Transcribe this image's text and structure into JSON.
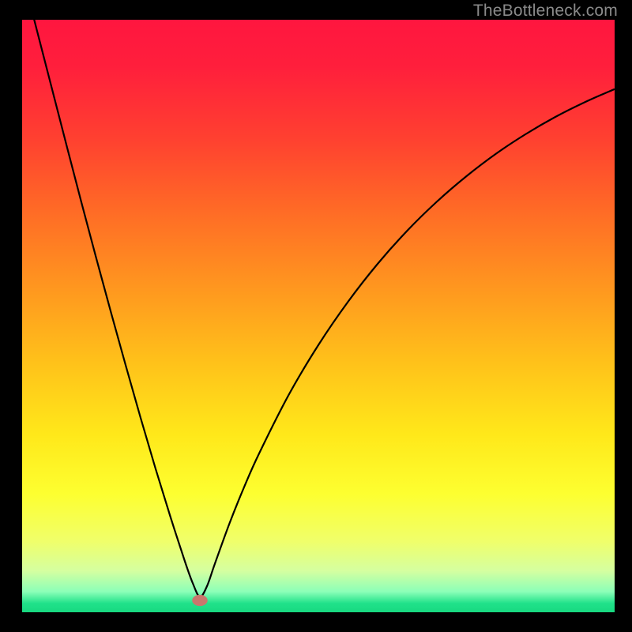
{
  "watermark": "TheBottleneck.com",
  "chart_data": {
    "type": "line",
    "title": "",
    "xlabel": "",
    "ylabel": "",
    "xlim": [
      0,
      100
    ],
    "ylim": [
      0,
      100
    ],
    "background_gradient": {
      "stops": [
        {
          "offset": 0.0,
          "color": "#ff163f"
        },
        {
          "offset": 0.08,
          "color": "#ff1f3c"
        },
        {
          "offset": 0.2,
          "color": "#ff4030"
        },
        {
          "offset": 0.32,
          "color": "#ff6a26"
        },
        {
          "offset": 0.45,
          "color": "#ff961f"
        },
        {
          "offset": 0.58,
          "color": "#ffc21a"
        },
        {
          "offset": 0.7,
          "color": "#ffe81a"
        },
        {
          "offset": 0.8,
          "color": "#fdff30"
        },
        {
          "offset": 0.88,
          "color": "#f0ff6a"
        },
        {
          "offset": 0.93,
          "color": "#d5ffa0"
        },
        {
          "offset": 0.965,
          "color": "#8cffb8"
        },
        {
          "offset": 0.985,
          "color": "#20e28a"
        },
        {
          "offset": 1.0,
          "color": "#18d880"
        }
      ]
    },
    "series": [
      {
        "name": "bottleneck-curve",
        "color": "#000000",
        "width": 2.2,
        "x": [
          0.0,
          2.5,
          5.0,
          7.5,
          10.0,
          12.5,
          15.0,
          17.5,
          20.0,
          22.5,
          25.0,
          27.5,
          28.8,
          30.0,
          31.2,
          32.5,
          35.0,
          37.5,
          40.0,
          45.0,
          50.0,
          55.0,
          60.0,
          65.0,
          70.0,
          75.0,
          80.0,
          85.0,
          90.0,
          95.0,
          100.0
        ],
        "y": [
          108.0,
          98.2,
          88.5,
          78.8,
          69.2,
          59.8,
          50.6,
          41.6,
          32.8,
          24.3,
          16.2,
          8.5,
          4.9,
          2.6,
          4.4,
          8.1,
          15.0,
          21.2,
          26.8,
          36.7,
          45.1,
          52.4,
          58.8,
          64.4,
          69.3,
          73.6,
          77.4,
          80.7,
          83.6,
          86.1,
          88.3
        ]
      }
    ],
    "marker": {
      "name": "optimal-point",
      "x": 30.0,
      "y": 2.0,
      "rx": 1.3,
      "ry": 0.95,
      "color": "#c8776d"
    }
  }
}
